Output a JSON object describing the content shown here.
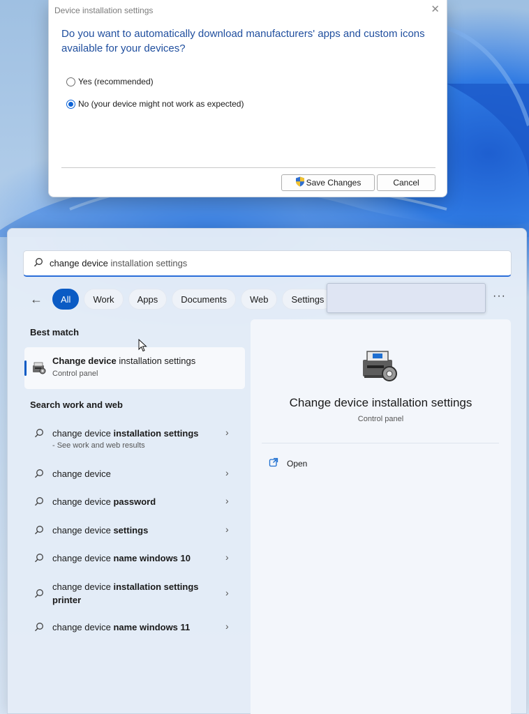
{
  "dialog": {
    "title": "Device installation settings",
    "close_glyph": "✕",
    "question": "Do you want to automatically download manufacturers' apps and custom icons available for your devices?",
    "options": [
      {
        "label": "Yes (recommended)",
        "selected": false
      },
      {
        "label": "No (your device might not work as expected)",
        "selected": true
      }
    ],
    "save_label": "Save Changes",
    "cancel_label": "Cancel",
    "save_icon": "uac-shield-icon"
  },
  "search": {
    "query_typed": "change device",
    "query_suggested": " installation settings"
  },
  "filters": {
    "back_glyph": "←",
    "chips": [
      "All",
      "Work",
      "Apps",
      "Documents",
      "Web",
      "Settings"
    ],
    "active": "All",
    "more_glyph": "···"
  },
  "best_match": {
    "heading": "Best match",
    "title_bold": "Change device",
    "title_rest": " installation settings",
    "subtitle": "Control panel",
    "icon": "device-installation-icon"
  },
  "web": {
    "heading": "Search work and web",
    "chevron_glyph": "›",
    "results": [
      {
        "plain": "change device ",
        "bold": "installation settings",
        "note": "- See work and web results"
      },
      {
        "plain": "change device",
        "bold": "",
        "note": ""
      },
      {
        "plain": "change device ",
        "bold": "password",
        "note": ""
      },
      {
        "plain": "change device ",
        "bold": "settings",
        "note": ""
      },
      {
        "plain": "change device ",
        "bold": "name windows 10",
        "note": ""
      },
      {
        "plain": "change device ",
        "bold": "installation settings",
        "bold2": "printer",
        "note": ""
      },
      {
        "plain": "change device ",
        "bold": "name windows 11",
        "note": ""
      }
    ]
  },
  "detail": {
    "title": "Change device installation settings",
    "subtitle": "Control panel",
    "open_label": "Open",
    "open_icon": "open-external-icon"
  },
  "colors": {
    "accent": "#0b5bc4",
    "dialog_question": "#1f4e9e"
  }
}
